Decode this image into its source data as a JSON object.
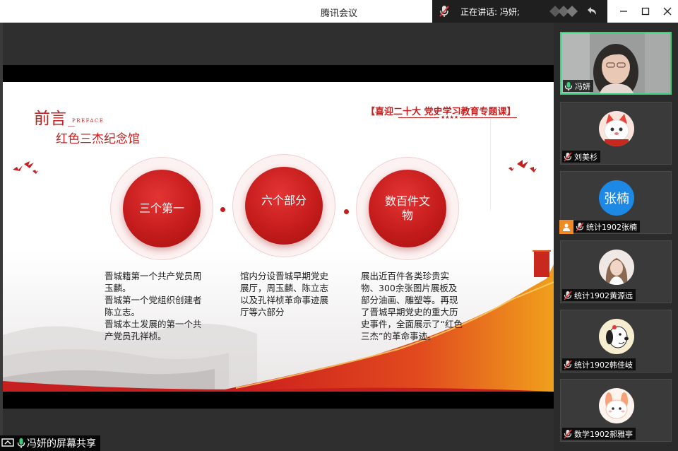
{
  "window": {
    "title": "腾讯会议",
    "speaking": "正在讲话: 冯妍;"
  },
  "slide": {
    "heading": "前言",
    "heading_en": "PREFACE",
    "subtitle": "红色三杰纪念馆",
    "topic": "【喜迎二十大 党史学习教育专题课】",
    "topic_stars": "★★★★",
    "circles": [
      {
        "label": "三个第一"
      },
      {
        "label": "六个部分"
      },
      {
        "label": "数百件文物"
      }
    ],
    "descriptions": [
      "晋城籍第一个共产党员周玉麟。\n晋城第一个党组织创建者陈立志。\n晋城本土发展的第一个共产党员孔祥桢。",
      "馆内分设晋城早期党史展厅，周玉麟、陈立志以及孔祥桢革命事迹展厅等六部分",
      "展出近百件各类珍贵实物、300余张图片展板及部分油画、雕塑等。再现了晋城早期党史的重大历史事件，全面展示了“红色三杰”的革命事迹。"
    ]
  },
  "participants": [
    {
      "name": "冯妍",
      "type": "video",
      "mic": "on",
      "active": true
    },
    {
      "name": "刘美杉",
      "type": "avatar",
      "avatar": "cat-avatar-icon",
      "mic": "off"
    },
    {
      "name": "统计1902张楠",
      "type": "text-avatar",
      "avatar_text": "张楠",
      "mic": "off",
      "badge": true
    },
    {
      "name": "统计1902黄源远",
      "type": "avatar",
      "avatar": "photo-avatar-icon",
      "mic": "off"
    },
    {
      "name": "统计1902韩佳岐",
      "type": "avatar",
      "avatar": "snoopy-avatar-icon",
      "mic": "off"
    },
    {
      "name": "数学1902郝雅亭",
      "type": "avatar",
      "avatar": "bunny-avatar-icon",
      "mic": "off"
    }
  ],
  "screen_share": {
    "label": "冯妍的屏幕共享"
  },
  "colors": {
    "accent_red": "#c51f1f",
    "active_border": "#3bd07a",
    "avatar_blue": "#1e88e5"
  }
}
